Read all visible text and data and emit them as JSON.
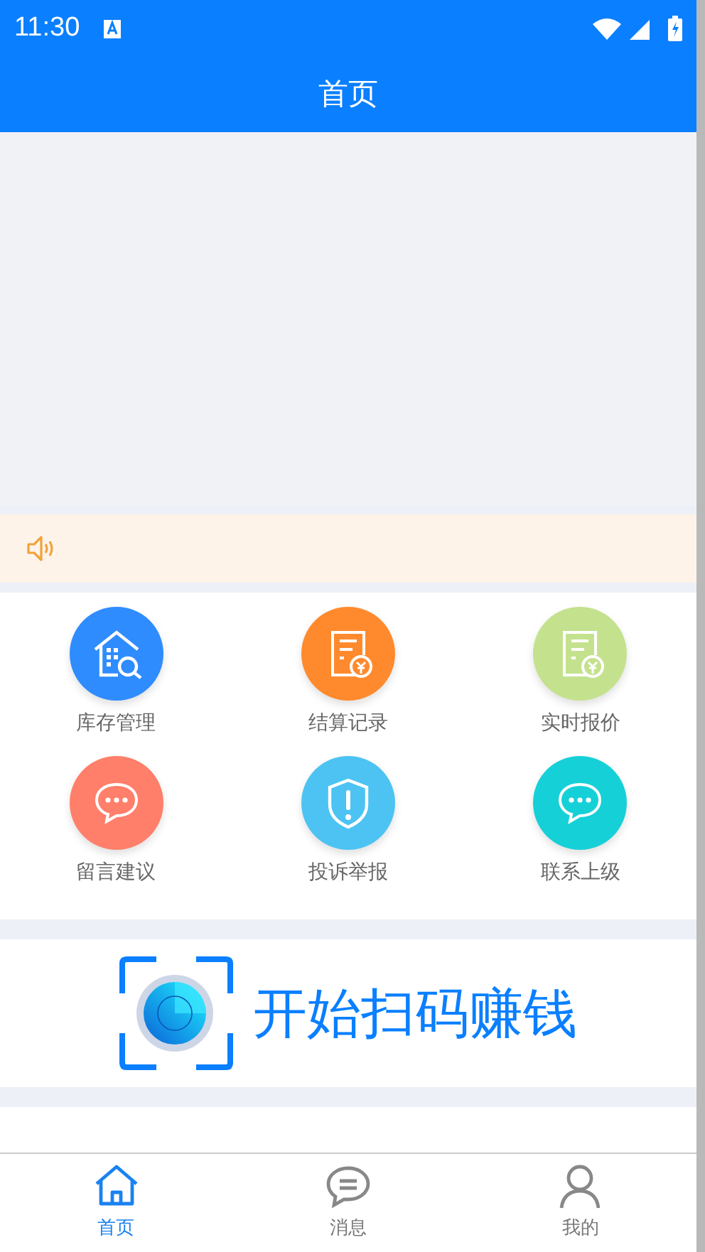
{
  "status_bar": {
    "time": "11:30"
  },
  "header": {
    "title": "首页"
  },
  "grid": [
    {
      "label": "库存管理",
      "kind": "warehouse",
      "color": "#2f8cff"
    },
    {
      "label": "结算记录",
      "kind": "bill",
      "color": "#ff8a2e"
    },
    {
      "label": "实时报价",
      "kind": "bill",
      "color": "#c4e28e"
    },
    {
      "label": "留言建议",
      "kind": "chat",
      "color": "#ff7f6a"
    },
    {
      "label": "投诉举报",
      "kind": "shield",
      "color": "#4cc3f2"
    },
    {
      "label": "联系上级",
      "kind": "chat",
      "color": "#16d0d8"
    }
  ],
  "scan_banner": {
    "text": "开始扫码赚钱"
  },
  "tab_bar": [
    {
      "label": "首页",
      "kind": "home",
      "selected": true
    },
    {
      "label": "消息",
      "kind": "message",
      "selected": false
    },
    {
      "label": "我的",
      "kind": "user",
      "selected": false
    }
  ]
}
